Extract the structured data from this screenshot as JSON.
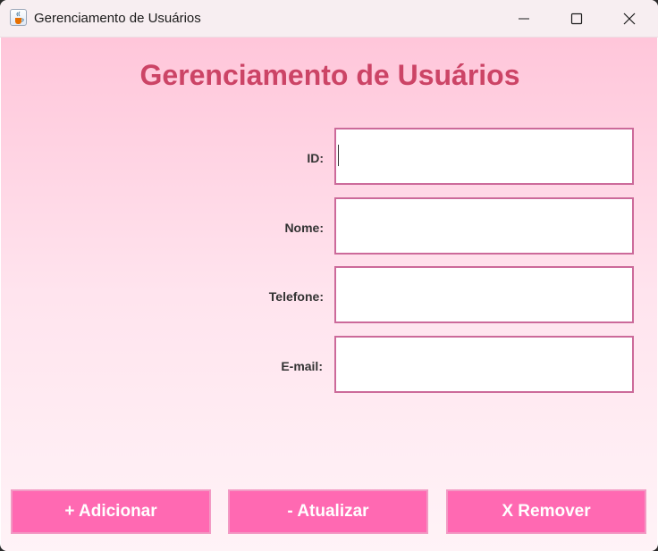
{
  "window": {
    "title": "Gerenciamento de Usuários",
    "app_icon": "java-cup-icon"
  },
  "header": {
    "title": "Gerenciamento de Usuários"
  },
  "form": {
    "fields": [
      {
        "label": "ID:",
        "value": "",
        "placeholder": ""
      },
      {
        "label": "Nome:",
        "value": "",
        "placeholder": ""
      },
      {
        "label": "Telefone:",
        "value": "",
        "placeholder": ""
      },
      {
        "label": "E-mail:",
        "value": "",
        "placeholder": ""
      }
    ]
  },
  "actions": {
    "add_label": "+ Adicionar",
    "update_label": "- Atualizar",
    "remove_label": "X Remover"
  },
  "colors": {
    "heading": "#cc4466",
    "button_bg": "#ff69b2",
    "input_border": "#cc6a9a",
    "background_top": "#ffc6da"
  }
}
